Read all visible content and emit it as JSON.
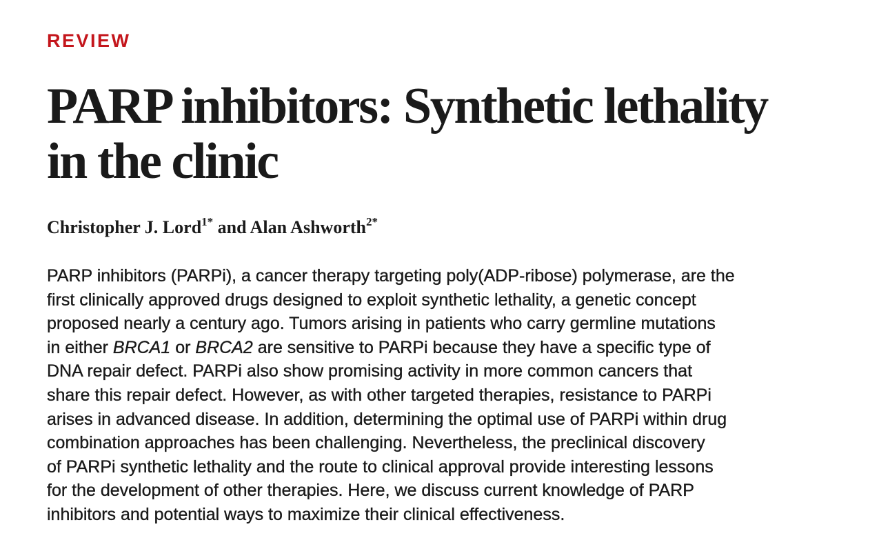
{
  "section_label": "REVIEW",
  "title": {
    "line1": "PARP inhibitors: Synthetic lethality",
    "line2": "in the clinic"
  },
  "authors": [
    {
      "name": "Christopher J. Lord",
      "affiliation": "1",
      "mark": "*"
    },
    {
      "name": "Alan Ashworth",
      "affiliation": "2",
      "mark": "*"
    }
  ],
  "author_conjunction": "and",
  "abstract": {
    "lines": [
      "PARP inhibitors (PARPi), a cancer therapy targeting poly(ADP-ribose) polymerase, are the",
      "first clinically approved drugs designed to exploit synthetic lethality, a genetic concept",
      "proposed nearly a century ago. Tumors arising in patients who carry germline mutations",
      {
        "pre": "in either ",
        "gene1": "BRCA1",
        "mid": " or ",
        "gene2": "BRCA2",
        "post": " are sensitive to PARPi because they have a specific type of"
      },
      "DNA repair defect. PARPi also show promising activity in more common cancers that",
      "share this repair defect. However, as with other targeted therapies, resistance to PARPi",
      "arises in advanced disease. In addition, determining the optimal use of PARPi within drug",
      "combination approaches has been challenging. Nevertheless, the preclinical discovery",
      "of PARPi synthetic lethality and the route to clinical approval provide interesting lessons",
      "for the development of other therapies. Here, we discuss current knowledge of PARP",
      "inhibitors and potential ways to maximize their clinical effectiveness."
    ]
  },
  "colors": {
    "accent": "#c4161c",
    "text": "#1a1a1a",
    "background": "#ffffff"
  }
}
